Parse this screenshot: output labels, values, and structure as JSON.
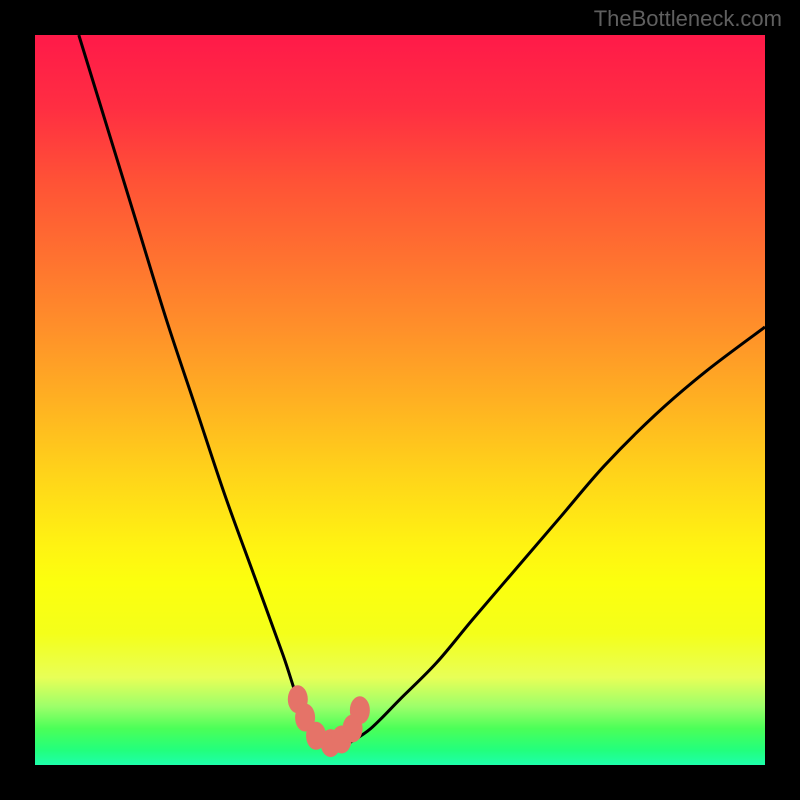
{
  "watermark": "TheBottleneck.com",
  "chart_data": {
    "type": "line",
    "title": "",
    "xlabel": "",
    "ylabel": "",
    "xlim": [
      0,
      100
    ],
    "ylim": [
      0,
      100
    ],
    "note": "Bottleneck V-curve: y ≈ relative bottleneck %, x ≈ component balance. Minimum near x≈38–43 at y≈3. Left branch starts at (6,100), right branch ends at (100,60). Values estimated from pixels; no axis ticks present.",
    "series": [
      {
        "name": "left-branch",
        "x": [
          6,
          10,
          14,
          18,
          22,
          26,
          30,
          34,
          36,
          38,
          40
        ],
        "y": [
          100,
          87,
          74,
          61,
          49,
          37,
          26,
          15,
          9,
          5,
          3
        ]
      },
      {
        "name": "right-branch",
        "x": [
          43,
          46,
          50,
          55,
          60,
          66,
          72,
          78,
          85,
          92,
          100
        ],
        "y": [
          3,
          5,
          9,
          14,
          20,
          27,
          34,
          41,
          48,
          54,
          60
        ]
      },
      {
        "name": "markers",
        "x": [
          36.0,
          37.0,
          38.5,
          40.5,
          42.0,
          43.5,
          44.5
        ],
        "y": [
          9.0,
          6.5,
          4.0,
          3.0,
          3.5,
          5.0,
          7.5
        ]
      }
    ],
    "gradient_stops": [
      {
        "pos": 0.0,
        "color": "#ff1a49"
      },
      {
        "pos": 0.5,
        "color": "#ffb022"
      },
      {
        "pos": 0.75,
        "color": "#fcff0e"
      },
      {
        "pos": 1.0,
        "color": "#1effab"
      }
    ]
  }
}
